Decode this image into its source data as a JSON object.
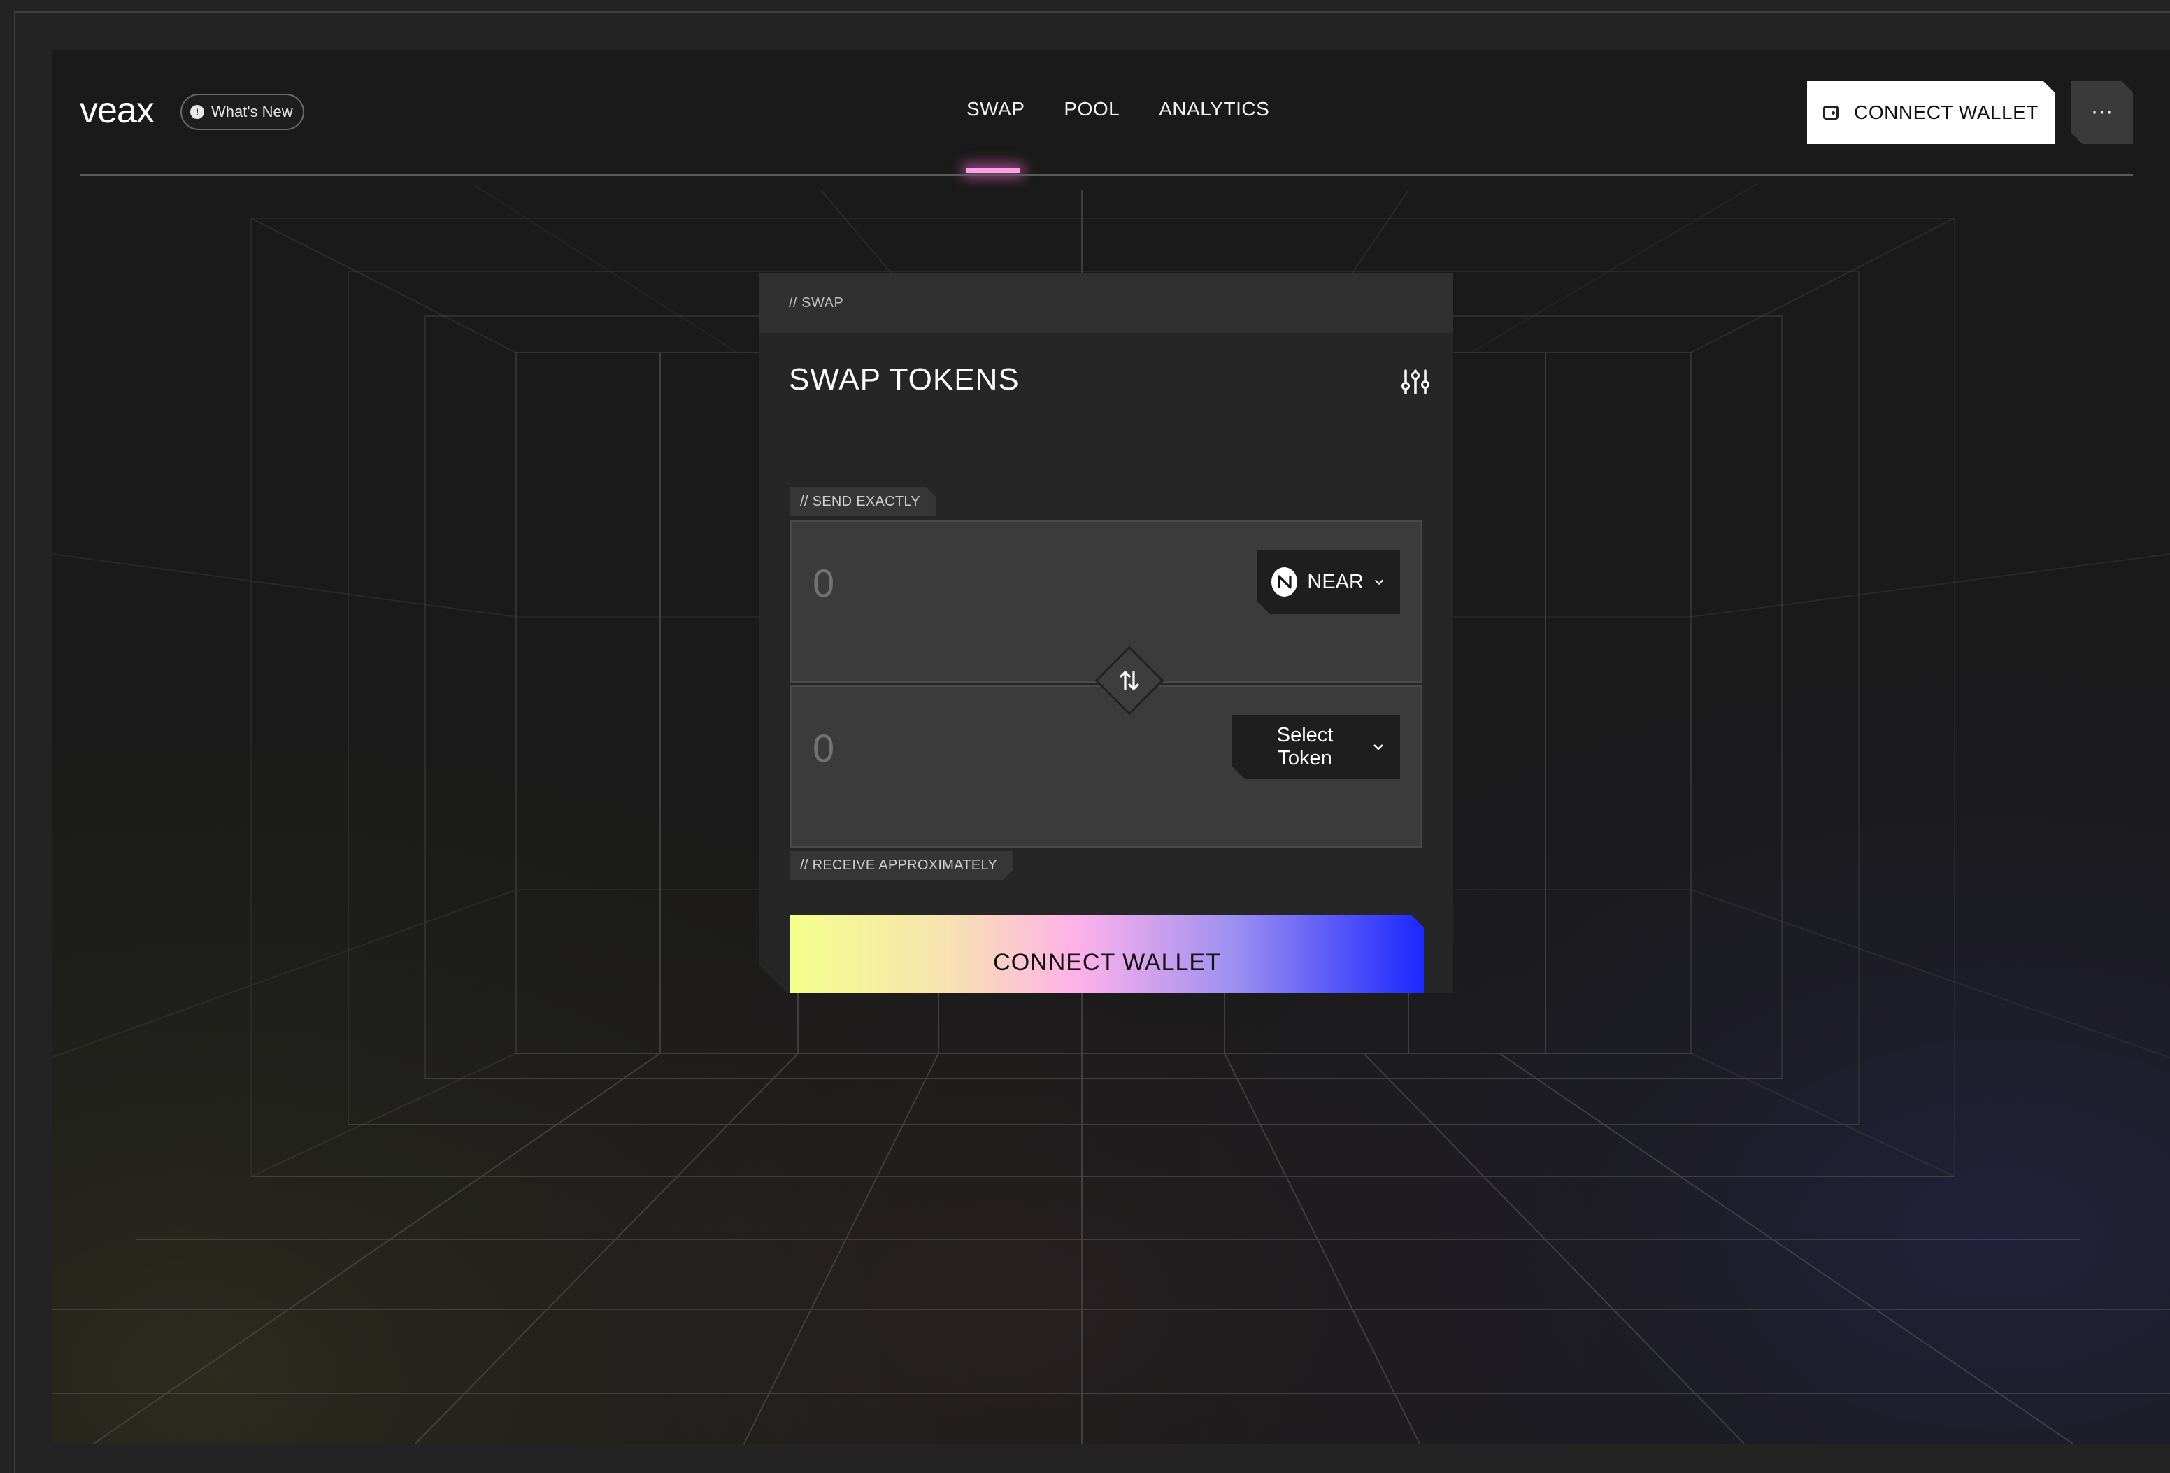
{
  "header": {
    "logo": "veax",
    "whats_new": "What's New",
    "nav": [
      {
        "label": "SWAP",
        "active": true
      },
      {
        "label": "POOL",
        "active": false
      },
      {
        "label": "ANALYTICS",
        "active": false
      }
    ],
    "connect_wallet": "CONNECT WALLET",
    "more": "···"
  },
  "swap": {
    "section_tag": "// SWAP",
    "title": "SWAP TOKENS",
    "send_label": "// SEND EXACTLY",
    "receive_label": "// RECEIVE APPROXIMATELY",
    "send_placeholder": "0",
    "receive_placeholder": "0",
    "send_token": "NEAR",
    "receive_token": "Select Token",
    "connect_wallet": "CONNECT WALLET"
  },
  "colors": {
    "nav_indicator": "#ff9ee8",
    "gradient": [
      "#f4ff8c",
      "#ffb2ea",
      "#1c28ff"
    ]
  }
}
